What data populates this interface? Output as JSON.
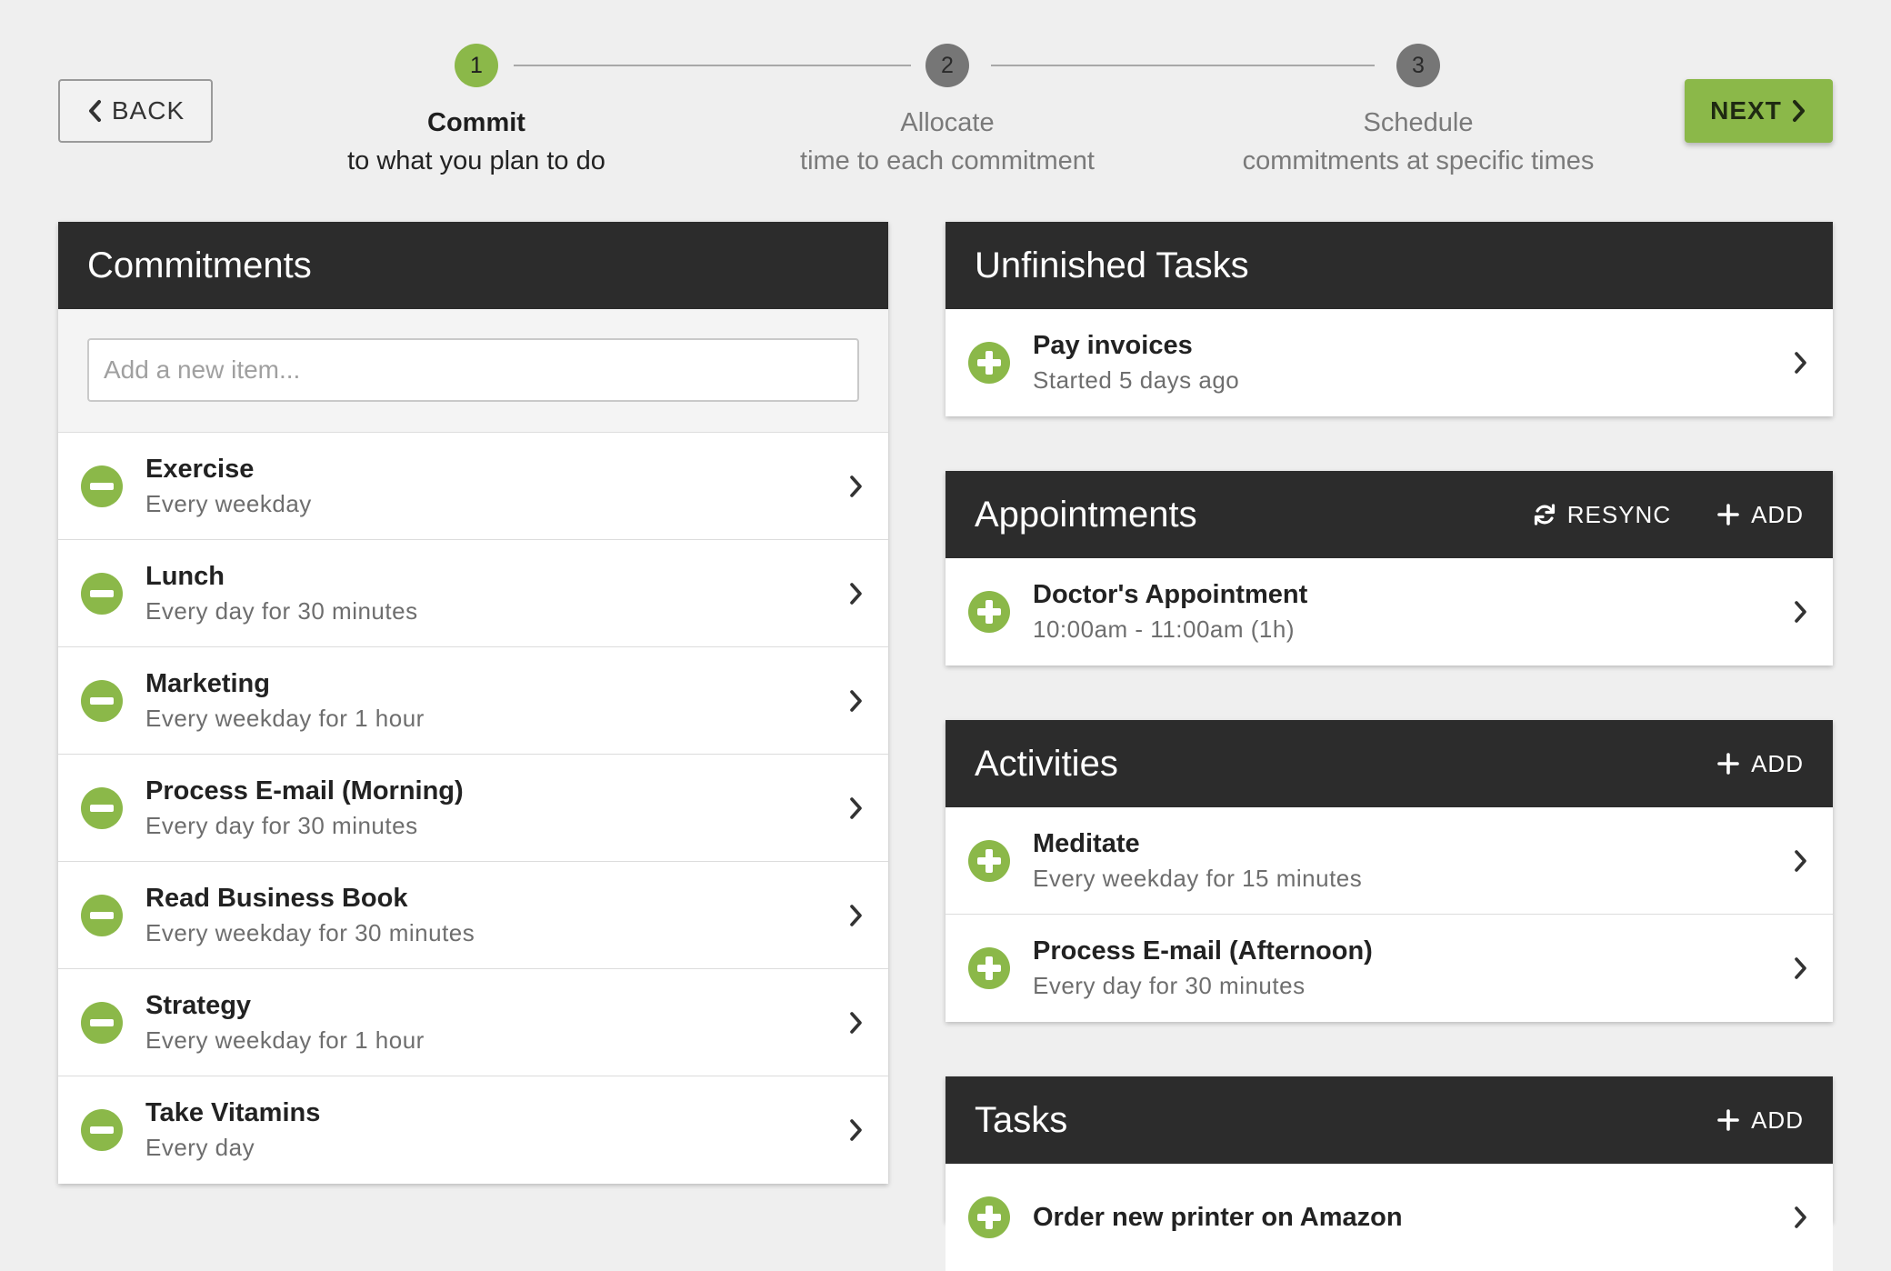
{
  "nav": {
    "back_label": "BACK",
    "next_label": "NEXT"
  },
  "stepper": [
    {
      "number": "1",
      "title": "Commit",
      "subtitle": "to what you plan to do",
      "active": true
    },
    {
      "number": "2",
      "title": "Allocate",
      "subtitle": "time to each commitment",
      "active": false
    },
    {
      "number": "3",
      "title": "Schedule",
      "subtitle": "commitments at specific times",
      "active": false
    }
  ],
  "commitments": {
    "title": "Commitments",
    "input_placeholder": "Add a new item...",
    "items": [
      {
        "title": "Exercise",
        "subtitle": "Every weekday"
      },
      {
        "title": "Lunch",
        "subtitle": "Every day for 30 minutes"
      },
      {
        "title": "Marketing",
        "subtitle": "Every weekday for 1 hour"
      },
      {
        "title": "Process E-mail (Morning)",
        "subtitle": "Every day for 30 minutes"
      },
      {
        "title": "Read Business Book",
        "subtitle": "Every weekday for 30 minutes"
      },
      {
        "title": "Strategy",
        "subtitle": "Every weekday for 1 hour"
      },
      {
        "title": "Take Vitamins",
        "subtitle": "Every day"
      }
    ]
  },
  "unfinished_tasks": {
    "title": "Unfinished Tasks",
    "items": [
      {
        "title": "Pay invoices",
        "subtitle": "Started 5 days ago"
      }
    ]
  },
  "appointments": {
    "title": "Appointments",
    "resync_label": "RESYNC",
    "add_label": "ADD",
    "items": [
      {
        "title": "Doctor's Appointment",
        "subtitle": "10:00am - 11:00am (1h)"
      }
    ]
  },
  "activities": {
    "title": "Activities",
    "add_label": "ADD",
    "items": [
      {
        "title": "Meditate",
        "subtitle": "Every weekday for 15 minutes"
      },
      {
        "title": "Process E-mail (Afternoon)",
        "subtitle": "Every day for 30 minutes"
      }
    ]
  },
  "tasks": {
    "title": "Tasks",
    "add_label": "ADD",
    "items": [
      {
        "title": "Order new printer on Amazon",
        "subtitle": ""
      }
    ]
  },
  "colors": {
    "accent_green": "#8bb849",
    "header_dark": "#2c2c2c",
    "background": "#efefef"
  }
}
